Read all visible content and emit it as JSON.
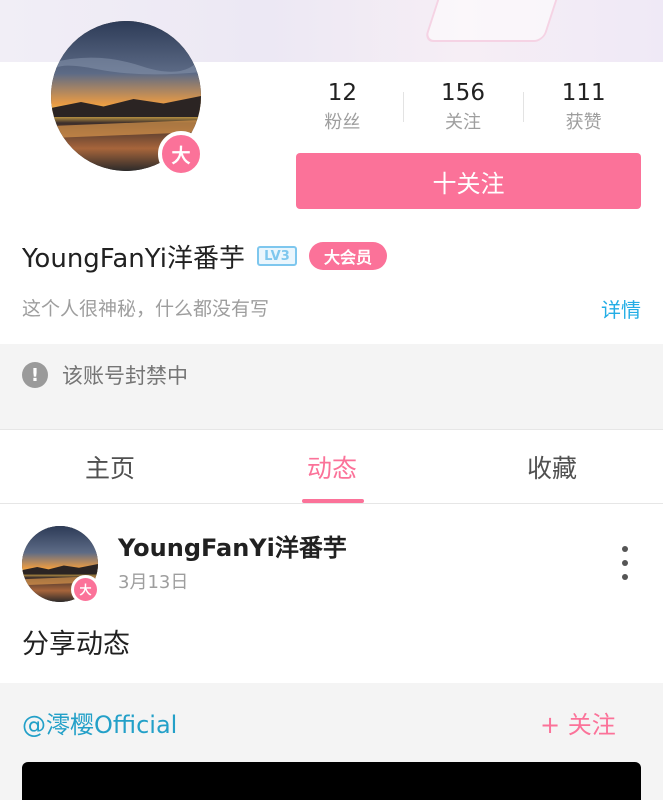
{
  "profile": {
    "avatar_icon": "sunset-landscape-avatar",
    "vip_badge": "大",
    "stats": [
      {
        "count": "12",
        "label": "粉丝"
      },
      {
        "count": "156",
        "label": "关注"
      },
      {
        "count": "111",
        "label": "获赞"
      }
    ],
    "follow_label": "十关注",
    "username": "YoungFanYi洋番芋",
    "level": "LV3",
    "vip_tag": "大会员",
    "bio": "这个人很神秘，什么都没有写",
    "detail_link": "详情",
    "banned_notice": "该账号封禁中"
  },
  "tabs": [
    {
      "label": "主页",
      "active": false
    },
    {
      "label": "动态",
      "active": true
    },
    {
      "label": "收藏",
      "active": false
    }
  ],
  "post": {
    "author": "YoungFanYi洋番芋",
    "vip_badge": "大",
    "date": "3月13日",
    "text": "分享动态",
    "repost_user": "@澪樱Official",
    "repost_follow": "+ 关注"
  },
  "colors": {
    "accent_pink": "#fb7299",
    "link_blue": "#23ade5",
    "level_blue": "#7ec7ee"
  }
}
